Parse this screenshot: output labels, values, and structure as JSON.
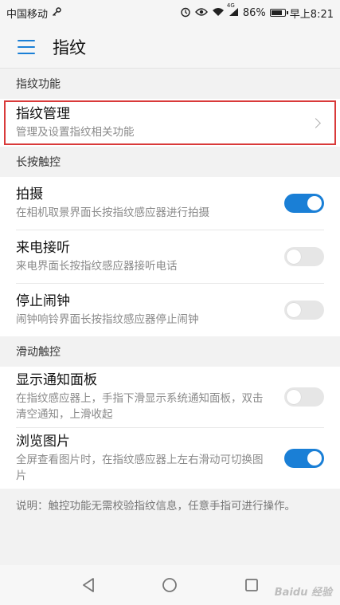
{
  "status_bar": {
    "carrier": "中国移动",
    "signal_label": "4G",
    "battery": "86%",
    "battery_level": 0.86,
    "time": "早上8:21"
  },
  "app_bar": {
    "title": "指纹"
  },
  "sections": {
    "fingerprint_function": {
      "header": "指纹功能",
      "items": [
        {
          "title": "指纹管理",
          "subtitle": "管理及设置指纹相关功能"
        }
      ]
    },
    "long_press": {
      "header": "长按触控",
      "items": [
        {
          "title": "拍摄",
          "subtitle": "在相机取景界面长按指纹感应器进行拍摄",
          "toggle": true
        },
        {
          "title": "来电接听",
          "subtitle": "来电界面长按指纹感应器接听电话",
          "toggle": false
        },
        {
          "title": "停止闹钟",
          "subtitle": "闹钟响铃界面长按指纹感应器停止闹钟",
          "toggle": false
        }
      ]
    },
    "swipe": {
      "header": "滑动触控",
      "items": [
        {
          "title": "显示通知面板",
          "subtitle": "在指纹感应器上，手指下滑显示系统通知面板，双击清空通知，上滑收起",
          "toggle": false
        },
        {
          "title": "浏览图片",
          "subtitle": "全屏查看图片时，在指纹感应器上左右滑动可切换图片",
          "toggle": true
        }
      ]
    }
  },
  "note": "说明：触控功能无需校验指纹信息，任意手指可进行操作。",
  "watermark": "Baidu 经验",
  "colors": {
    "accent": "#1a7fd6",
    "highlight_border": "#d93a3a"
  },
  "icons": [
    "key-icon",
    "alarm-icon",
    "eye-icon",
    "wifi-icon",
    "signal-icon",
    "battery-icon",
    "menu-icon",
    "chevron-right-icon",
    "back-icon",
    "home-icon",
    "recents-icon"
  ]
}
